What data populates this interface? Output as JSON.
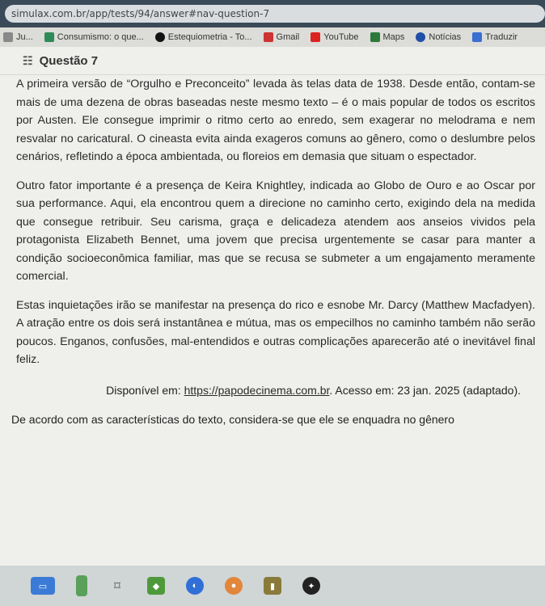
{
  "browser": {
    "url": "simulax.com.br/app/tests/94/answer#nav-question-7",
    "bookmarks": [
      {
        "label": "Ju...",
        "color": "#888888"
      },
      {
        "label": "Consumismo: o que...",
        "color": "#2e8b57"
      },
      {
        "label": "Estequiometria - To...",
        "color": "#111111"
      },
      {
        "label": "Gmail",
        "color": "#cc3333"
      },
      {
        "label": "YouTube",
        "color": "#dd2222"
      },
      {
        "label": "Maps",
        "color": "#2b7a3b"
      },
      {
        "label": "Notícias",
        "color": "#1f4fa8"
      },
      {
        "label": "Traduzir",
        "color": "#3b6fd1"
      }
    ]
  },
  "question": {
    "title": "Questão 7",
    "paragraphs": [
      "A primeira versão de “Orgulho e Preconceito” levada às telas data de 1938. Desde então, contam-se mais de uma dezena de obras baseadas neste mesmo texto – é o mais popular de todos os escritos por Austen. Ele consegue imprimir o ritmo certo ao enredo, sem exagerar no melodrama e nem resvalar no caricatural. O cineasta evita ainda exageros comuns ao gênero, como o deslumbre pelos cenários, refletindo a época ambientada, ou floreios em demasia que situam o espectador.",
      "Outro fator importante é a presença de Keira Knightley, indicada ao Globo de Ouro e ao Oscar por sua performance. Aqui, ela encontrou quem a direcione no caminho certo, exigindo dela na medida que consegue retribuir. Seu carisma, graça e delicadeza atendem aos anseios vividos pela protagonista Elizabeth Bennet, uma jovem que precisa urgentemente se casar para manter a condição socioeconômica familiar, mas que se recusa se submeter a um engajamento meramente comercial.",
      "Estas inquietações irão se manifestar na presença do rico e esnobe Mr. Darcy (Matthew Macfadyen). A atração entre os dois será instantânea e mútua, mas os empecilhos no caminho também não serão poucos. Enganos, confusões, mal-entendidos e outras complicações aparecerão até o inevitável final feliz."
    ],
    "source_prefix": "Disponível em: ",
    "source_link": "https://papodecinema.com.br",
    "source_suffix": ". Acesso em: 23 jan. 2025 (adaptado).",
    "stem": "De acordo com as características do texto, considera-se que ele se enquadra no gênero"
  },
  "taskbar": {
    "apps": [
      {
        "name": "files-icon",
        "color": "#3b7bd6"
      },
      {
        "name": "phone-icon",
        "color": "#5aa05a"
      },
      {
        "name": "menu-icon",
        "color": "#8a8a8a"
      },
      {
        "name": "drive-icon",
        "color": "#4e9a3a"
      },
      {
        "name": "chrome-icon",
        "color": "#2f6fd6"
      },
      {
        "name": "app-icon",
        "color": "#e2863b"
      },
      {
        "name": "chart-icon",
        "color": "#8a7a3a"
      },
      {
        "name": "notification-icon",
        "color": "#c0392b"
      }
    ]
  }
}
